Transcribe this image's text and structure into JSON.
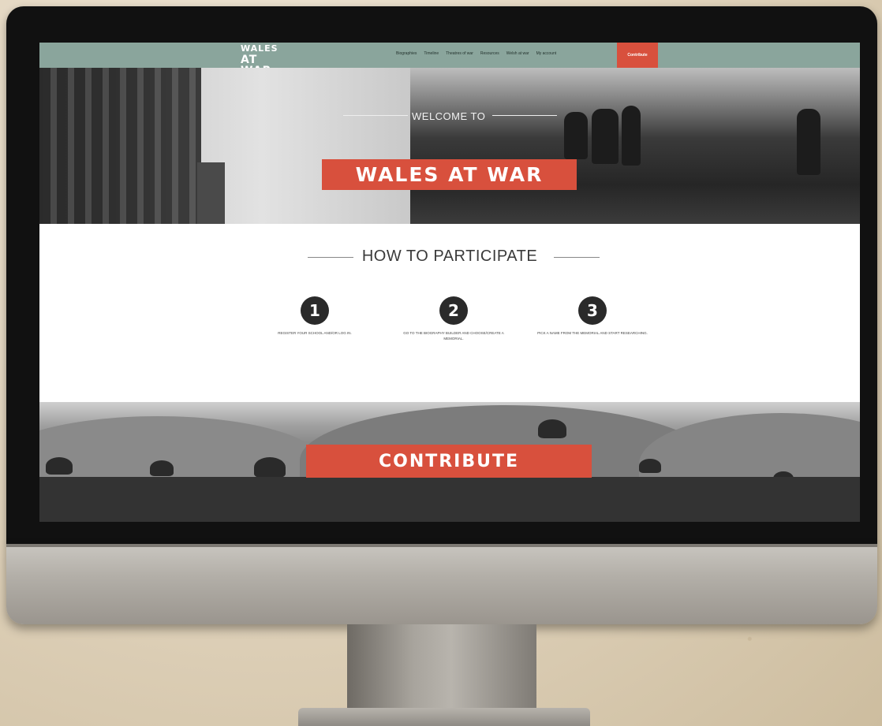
{
  "site": {
    "logo_line1": "WALES",
    "logo_line2": "AT WAR"
  },
  "nav": {
    "links": [
      "Biographies",
      "Timeline",
      "Theatres of war",
      "Resources",
      "Welsh at war",
      "My account"
    ],
    "cta": "Contribute"
  },
  "hero": {
    "welcome": "WELCOME TO",
    "title": "WALES AT WAR"
  },
  "participate": {
    "heading": "HOW TO PARTICIPATE",
    "steps": [
      {
        "number": "1",
        "text": "REGISTER YOUR SCHOOL AND/OR LOG IN."
      },
      {
        "number": "2",
        "text": "GO TO THE BIOGRAPHY BUILDER AND CHOOSE/CREATE A MEMORIAL."
      },
      {
        "number": "3",
        "text": "PICK A NAME FROM THE MEMORIAL AND START RESEARCHING."
      }
    ]
  },
  "contribute": {
    "label": "CONTRIBUTE"
  },
  "colors": {
    "navbar": "#8aa59c",
    "accent": "#d8503d"
  }
}
